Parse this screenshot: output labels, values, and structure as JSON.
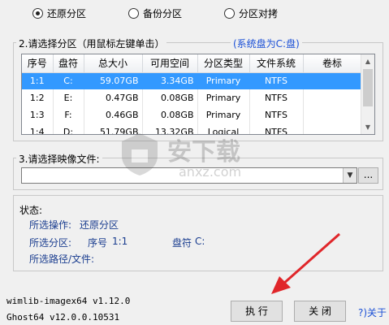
{
  "mode_options": [
    {
      "label": "还原分区",
      "selected": true
    },
    {
      "label": "备份分区",
      "selected": false
    },
    {
      "label": "分区对拷",
      "selected": false
    }
  ],
  "partition_section": {
    "title": "2.请选择分区（用鼠标左键单击）",
    "system_disk_note": "(系统盘为C:盘)",
    "columns": [
      "序号",
      "盘符",
      "总大小",
      "可用空间",
      "分区类型",
      "文件系统",
      "卷标"
    ],
    "rows": [
      {
        "no": "1:1",
        "drive": "C:",
        "total": "59.07GB",
        "free": "3.34GB",
        "type": "Primary",
        "fs": "NTFS",
        "label": "",
        "selected": true
      },
      {
        "no": "1:2",
        "drive": "E:",
        "total": "0.47GB",
        "free": "0.08GB",
        "type": "Primary",
        "fs": "NTFS",
        "label": "",
        "selected": false
      },
      {
        "no": "1:3",
        "drive": "F:",
        "total": "0.46GB",
        "free": "0.08GB",
        "type": "Primary",
        "fs": "NTFS",
        "label": "",
        "selected": false
      },
      {
        "no": "1:4",
        "drive": "D:",
        "total": "51.79GB",
        "free": "13.32GB",
        "type": "Logical",
        "fs": "NTFS",
        "label": "",
        "selected": false
      }
    ]
  },
  "image_section": {
    "title": "3.请选择映像文件:",
    "value": "",
    "browse_label": "..."
  },
  "status": {
    "title": "状态:",
    "operation_label": "所选操作:",
    "operation_value": "还原分区",
    "partition_label": "所选分区:",
    "partition_no_label": "序号",
    "partition_no_value": "1:1",
    "drive_label": "盘符",
    "drive_value": "C:",
    "path_label": "所选路径/文件:",
    "path_value": ""
  },
  "versions": {
    "wimlib": "wimlib-imagex64 v1.12.0",
    "ghost": "Ghost64 v12.0.0.10531"
  },
  "buttons": {
    "execute": "执 行",
    "close": "关 闭",
    "about": "?)关于"
  },
  "watermark": {
    "brand_cn": "安下载",
    "brand_url": "anxz.com"
  },
  "colors": {
    "selection": "#3399ff",
    "status_text": "#1a3d8f",
    "system_note": "#1a4fd6",
    "arrow": "#e0262a"
  }
}
